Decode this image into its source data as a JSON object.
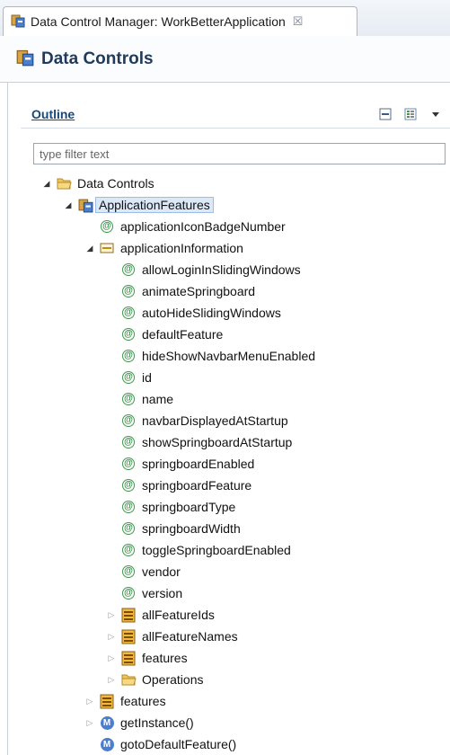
{
  "tab": {
    "title": "Data Control Manager: WorkBetterApplication",
    "close": "☒"
  },
  "editor": {
    "title": "Data Controls"
  },
  "outline": {
    "title": "Outline",
    "filter_placeholder": "type filter text"
  },
  "tree": [
    {
      "label": "Data Controls",
      "depth": 0,
      "twisty": "open",
      "icon": "folder"
    },
    {
      "label": "ApplicationFeatures",
      "depth": 1,
      "twisty": "open",
      "icon": "datacontrol",
      "selected": true
    },
    {
      "label": "applicationIconBadgeNumber",
      "depth": 2,
      "twisty": "none",
      "icon": "attribute"
    },
    {
      "label": "applicationInformation",
      "depth": 2,
      "twisty": "open",
      "icon": "struct"
    },
    {
      "label": "allowLoginInSlidingWindows",
      "depth": 3,
      "twisty": "none",
      "icon": "attribute"
    },
    {
      "label": "animateSpringboard",
      "depth": 3,
      "twisty": "none",
      "icon": "attribute"
    },
    {
      "label": "autoHideSlidingWindows",
      "depth": 3,
      "twisty": "none",
      "icon": "attribute"
    },
    {
      "label": "defaultFeature",
      "depth": 3,
      "twisty": "none",
      "icon": "attribute"
    },
    {
      "label": "hideShowNavbarMenuEnabled",
      "depth": 3,
      "twisty": "none",
      "icon": "attribute"
    },
    {
      "label": "id",
      "depth": 3,
      "twisty": "none",
      "icon": "attribute"
    },
    {
      "label": "name",
      "depth": 3,
      "twisty": "none",
      "icon": "attribute"
    },
    {
      "label": "navbarDisplayedAtStartup",
      "depth": 3,
      "twisty": "none",
      "icon": "attribute"
    },
    {
      "label": "showSpringboardAtStartup",
      "depth": 3,
      "twisty": "none",
      "icon": "attribute"
    },
    {
      "label": "springboardEnabled",
      "depth": 3,
      "twisty": "none",
      "icon": "attribute"
    },
    {
      "label": "springboardFeature",
      "depth": 3,
      "twisty": "none",
      "icon": "attribute"
    },
    {
      "label": "springboardType",
      "depth": 3,
      "twisty": "none",
      "icon": "attribute"
    },
    {
      "label": "springboardWidth",
      "depth": 3,
      "twisty": "none",
      "icon": "attribute"
    },
    {
      "label": "toggleSpringboardEnabled",
      "depth": 3,
      "twisty": "none",
      "icon": "attribute"
    },
    {
      "label": "vendor",
      "depth": 3,
      "twisty": "none",
      "icon": "attribute"
    },
    {
      "label": "version",
      "depth": 3,
      "twisty": "none",
      "icon": "attribute"
    },
    {
      "label": "allFeatureIds",
      "depth": 3,
      "twisty": "closed",
      "icon": "collection"
    },
    {
      "label": "allFeatureNames",
      "depth": 3,
      "twisty": "closed",
      "icon": "collection"
    },
    {
      "label": "features",
      "depth": 3,
      "twisty": "closed",
      "icon": "collection"
    },
    {
      "label": "Operations",
      "depth": 3,
      "twisty": "closed",
      "icon": "folder"
    },
    {
      "label": "features",
      "depth": 2,
      "twisty": "closed",
      "icon": "collection"
    },
    {
      "label": "getInstance()",
      "depth": 2,
      "twisty": "closed",
      "icon": "method"
    },
    {
      "label": "gotoDefaultFeature()",
      "depth": 2,
      "twisty": "none",
      "icon": "method"
    }
  ]
}
